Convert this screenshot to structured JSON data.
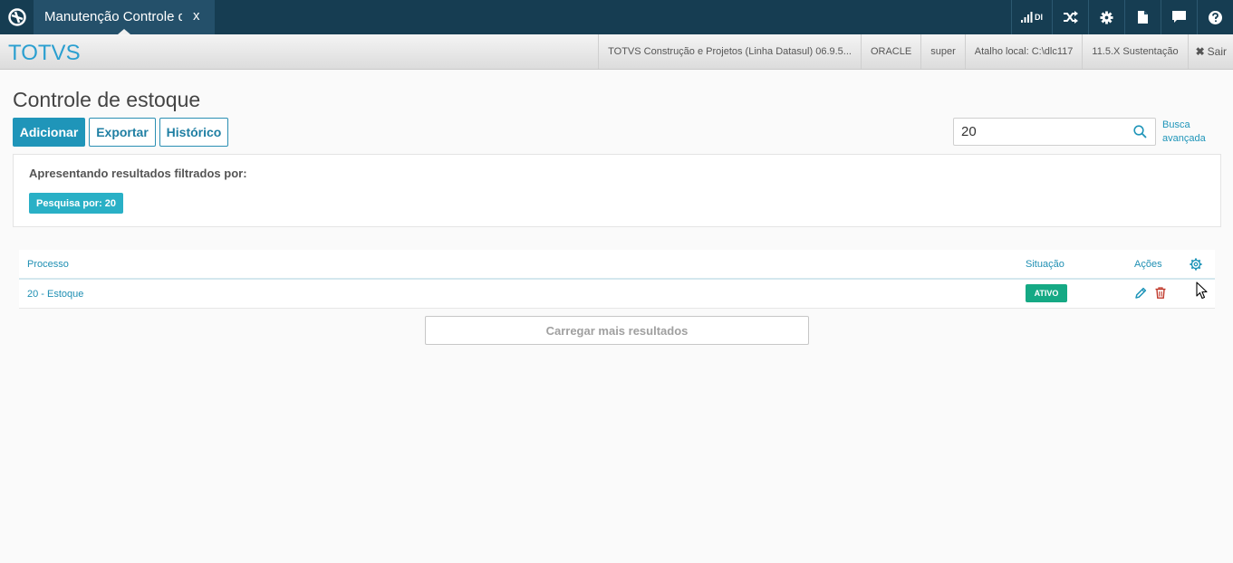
{
  "topbar": {
    "tab_label": "Manutenção Controle de estoque",
    "tab_close": "x",
    "signal_label": "DI",
    "icons": [
      "totvs-logo-icon",
      "signal-icon",
      "shuffle-icon",
      "gear-icon",
      "document-icon",
      "chat-icon",
      "help-icon"
    ]
  },
  "header": {
    "brand": "TOTVS",
    "product": "TOTVS Construção e Projetos (Linha Datasul) 06.9.5...",
    "database": "ORACLE",
    "user": "super",
    "shortcut": "Atalho local: C:\\dlc117",
    "version": "11.5.X Sustentação",
    "logout": "Sair"
  },
  "page": {
    "title": "Controle de estoque",
    "add_button": "Adicionar",
    "export_button": "Exportar",
    "history_button": "Histórico"
  },
  "search": {
    "value": "20",
    "advanced_line1": "Busca",
    "advanced_line2": "avançada"
  },
  "filter": {
    "title": "Apresentando resultados filtrados por:",
    "tag": "Pesquisa por: 20"
  },
  "table": {
    "columns": {
      "process": "Processo",
      "status": "Situação",
      "actions": "Ações"
    },
    "rows": [
      {
        "process": "20 - Estoque",
        "status": "ATIVO"
      }
    ]
  },
  "load_more": "Carregar mais resultados",
  "colors": {
    "topbar": "#163d52",
    "brand": "#2a9fd0",
    "primary": "#1f95b9",
    "tag": "#29b0c6",
    "status_active": "#15a984",
    "delete": "#c0392b"
  }
}
